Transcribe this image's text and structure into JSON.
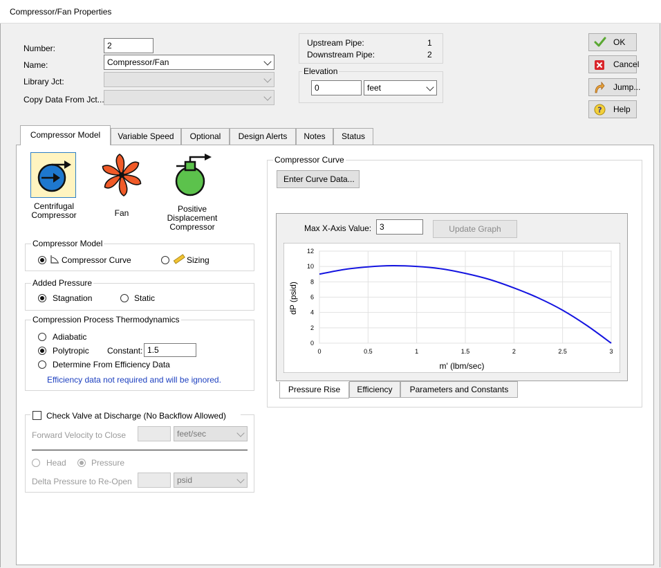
{
  "window": {
    "title": "Compressor/Fan Properties"
  },
  "fields": {
    "number_label": "Number:",
    "number_value": "2",
    "name_label": "Name:",
    "name_value": "Compressor/Fan",
    "library_label": "Library Jct:",
    "library_value": "",
    "copy_label": "Copy Data From Jct...",
    "copy_value": ""
  },
  "pipes": {
    "upstream_label": "Upstream Pipe:",
    "upstream_value": "1",
    "downstream_label": "Downstream Pipe:",
    "downstream_value": "2"
  },
  "elevation": {
    "title": "Elevation",
    "value": "0",
    "unit": "feet"
  },
  "buttons": {
    "ok": "OK",
    "cancel": "Cancel",
    "jump": "Jump...",
    "help": "Help"
  },
  "tabs": [
    {
      "label": "Compressor Model",
      "active": true
    },
    {
      "label": "Variable Speed"
    },
    {
      "label": "Optional"
    },
    {
      "label": "Design Alerts"
    },
    {
      "label": "Notes"
    },
    {
      "label": "Status"
    }
  ],
  "model_icons": {
    "centrifugal": "Centrifugal Compressor",
    "centrifugal_l1": "Centrifugal",
    "centrifugal_l2": "Compressor",
    "fan": "Fan",
    "pd_l1": "Positive",
    "pd_l2": "Displacement",
    "pd_l3": "Compressor"
  },
  "compressor_model": {
    "title": "Compressor Model",
    "curve": "Compressor Curve",
    "sizing": "Sizing",
    "selected": "curve"
  },
  "added_pressure": {
    "title": "Added Pressure",
    "stagnation": "Stagnation",
    "static": "Static",
    "selected": "stagnation"
  },
  "thermo": {
    "title": "Compression Process Thermodynamics",
    "adiabatic": "Adiabatic",
    "polytropic": "Polytropic",
    "constant_label": "Constant:",
    "constant_value": "1.5",
    "efficiency": "Determine From Efficiency Data",
    "note": "Efficiency data not required and will be ignored.",
    "selected": "polytropic"
  },
  "check_valve": {
    "label": "Check Valve at Discharge (No Backflow Allowed)",
    "checked": false,
    "forward_label": "Forward Velocity to Close",
    "forward_value": "",
    "forward_unit": "feet/sec",
    "head": "Head",
    "pressure": "Pressure",
    "reopen_label": "Delta Pressure to Re-Open",
    "reopen_value": "",
    "reopen_unit": "psid"
  },
  "curve_panel": {
    "title": "Compressor Curve",
    "enter_button": "Enter Curve Data...",
    "max_x_label": "Max X-Axis Value:",
    "max_x_value": "3",
    "update_button": "Update Graph",
    "subtabs": [
      "Pressure Rise",
      "Efficiency",
      "Parameters and Constants"
    ]
  },
  "chart_data": {
    "type": "line",
    "xlabel": "m' (lbm/sec)",
    "ylabel": "dP (psid)",
    "xlim": [
      0,
      3
    ],
    "ylim": [
      0,
      12
    ],
    "xticks": [
      "0",
      "0.5",
      "1",
      "1.5",
      "2",
      "2.5",
      "3"
    ],
    "yticks": [
      "0",
      "2",
      "4",
      "6",
      "8",
      "10",
      "12"
    ],
    "grid": true,
    "color": "#1414e0",
    "series": [
      {
        "x": [
          0,
          0.25,
          0.5,
          0.75,
          1.0,
          1.25,
          1.5,
          1.75,
          2.0,
          2.25,
          2.5,
          2.75,
          3.0
        ],
        "values": [
          9.0,
          9.6,
          9.95,
          10.1,
          10.0,
          9.7,
          9.1,
          8.3,
          7.2,
          5.9,
          4.3,
          2.3,
          0.0
        ]
      }
    ]
  }
}
